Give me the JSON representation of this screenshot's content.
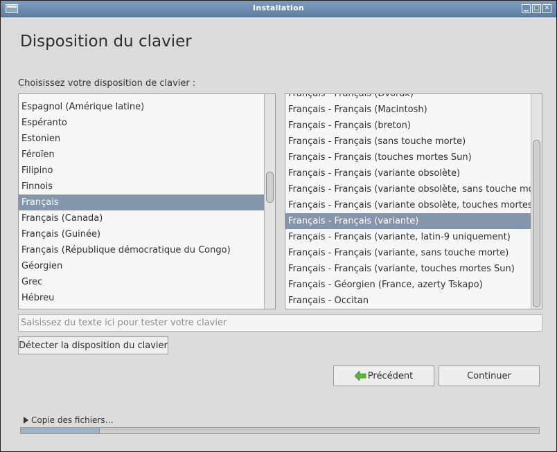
{
  "window": {
    "title": "Installation",
    "controls": {
      "minimize": "▁",
      "maximize": "□",
      "close": "✕"
    }
  },
  "page": {
    "title": "Disposition du clavier",
    "prompt": "Choisissez votre disposition de clavier :"
  },
  "layouts": {
    "items": [
      "Espagnol (Amérique latine)",
      "Espéranto",
      "Estonien",
      "Féroïen",
      "Filipino",
      "Finnois",
      "Français",
      "Français (Canada)",
      "Français (Guinée)",
      "Français (République démocratique du Congo)",
      "Géorgien",
      "Grec",
      "Hébreu"
    ],
    "selected_index": 6
  },
  "variants": {
    "items": [
      "Français - Français (Dvorak)",
      "Français - Français (Macintosh)",
      "Français - Français (breton)",
      "Français - Français (sans touche morte)",
      "Français - Français (touches mortes Sun)",
      "Français - Français (variante obsolète)",
      "Français - Français (variante obsolète, sans touche morte)",
      "Français - Français (variante obsolète, touches mortes Sun)",
      "Français - Français (variante)",
      "Français - Français (variante, latin-9 uniquement)",
      "Français - Français (variante, sans touche morte)",
      "Français - Français (variante, touches mortes Sun)",
      "Français - Géorgien (France, azerty Tskapo)",
      "Français - Occitan"
    ],
    "selected_index": 8
  },
  "test_field": {
    "placeholder": "Saisissez du texte ici pour tester votre clavier",
    "value": ""
  },
  "buttons": {
    "detect": "Détecter la disposition du clavier",
    "previous": "Précédent",
    "continue": "Continuer"
  },
  "status": {
    "expander_label": "Copie des fichiers…",
    "progress_fraction": 0.153
  },
  "colors": {
    "selection": "#8496ab",
    "titlebar": "#6f8db1",
    "progress": "#9db3c9",
    "arrow_green": "#5cb833"
  }
}
